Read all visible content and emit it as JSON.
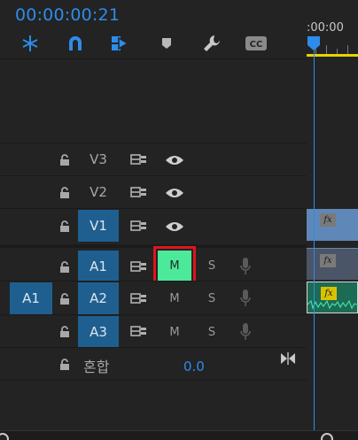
{
  "timecode": "00:00:00:21",
  "ruler": {
    "label": ":00:00"
  },
  "toolbar": {
    "icons": [
      "snap-icon",
      "magnet-icon",
      "linked-selection-icon",
      "add-marker-icon",
      "wrench-icon",
      "captions-icon"
    ],
    "captions_label": "CC"
  },
  "tracks": {
    "V3": {
      "name": "V3"
    },
    "V2": {
      "name": "V2"
    },
    "V1": {
      "name": "V1"
    },
    "A1": {
      "name": "A1",
      "mute": "M",
      "solo": "S"
    },
    "A2": {
      "name": "A2",
      "source": "A1",
      "mute": "M",
      "solo": "S"
    },
    "A3": {
      "name": "A3",
      "mute": "M",
      "solo": "S"
    }
  },
  "mix": {
    "label": "혼합",
    "value": "0.0"
  },
  "clips": {
    "fx": "fx"
  },
  "colors": {
    "accent": "#2d8ceb",
    "track_target": "#1f5f90",
    "mute_on": "#4ce99b",
    "highlight_box": "#e0141c",
    "work_area": "#e6d400"
  }
}
